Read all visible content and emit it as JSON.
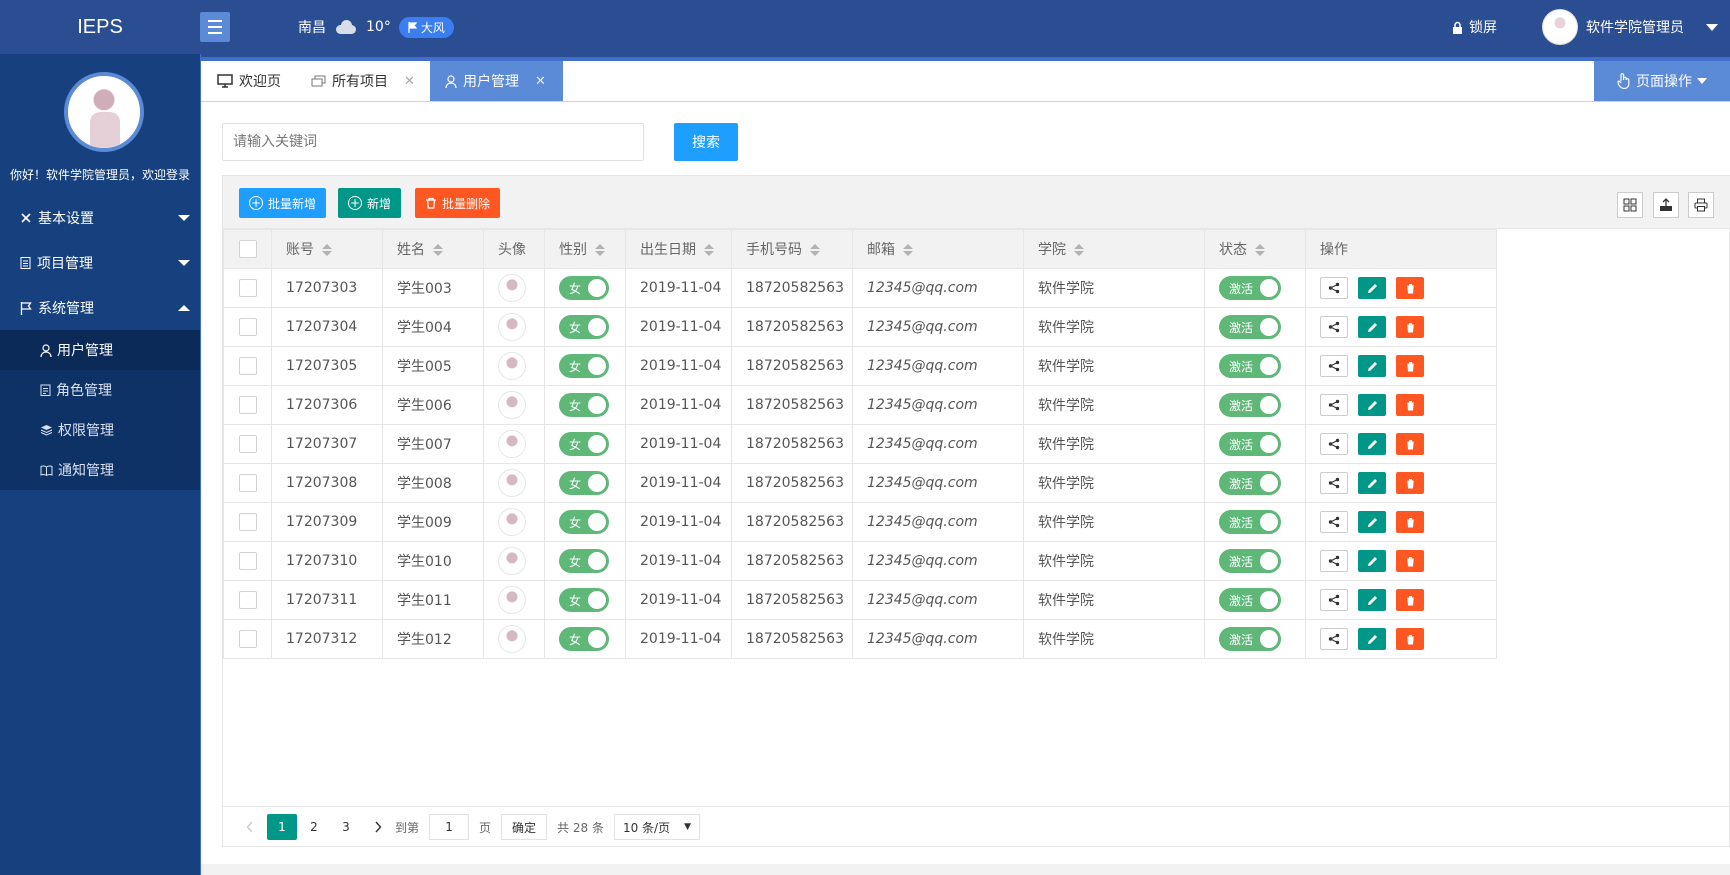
{
  "app": {
    "logo": "IEPS"
  },
  "header": {
    "city": "南昌",
    "temperature": "10°",
    "wind": "大风",
    "lock_label": "锁屏",
    "user_name": "软件学院管理员"
  },
  "sidebar": {
    "welcome": "你好！软件学院管理员，欢迎登录",
    "menus": [
      {
        "label": "基本设置",
        "icon": "tools-icon"
      },
      {
        "label": "项目管理",
        "icon": "document-icon"
      },
      {
        "label": "系统管理",
        "icon": "flag-icon"
      }
    ],
    "submenu": [
      {
        "label": "用户管理",
        "icon": "user-icon",
        "active": true
      },
      {
        "label": "角色管理",
        "icon": "clipboard-icon"
      },
      {
        "label": "权限管理",
        "icon": "layers-icon"
      },
      {
        "label": "通知管理",
        "icon": "book-icon"
      }
    ]
  },
  "tabs": [
    {
      "label": "欢迎页",
      "icon": "monitor-icon"
    },
    {
      "label": "所有项目",
      "icon": "folders-icon"
    },
    {
      "label": "用户管理",
      "icon": "user-icon",
      "active": true
    }
  ],
  "page_op": "页面操作",
  "search": {
    "placeholder": "请输入关键词",
    "button": "搜索"
  },
  "toolbar": {
    "batch_add": "批量新增",
    "add": "新增",
    "batch_delete": "批量删除"
  },
  "table": {
    "columns": [
      "账号",
      "姓名",
      "头像",
      "性别",
      "出生日期",
      "手机号码",
      "邮箱",
      "学院",
      "状态",
      "操作"
    ],
    "rows": [
      {
        "account": "17207303",
        "name": "学生003",
        "sex": "女",
        "birth": "2019-11-04",
        "phone": "18720582563",
        "email": "12345@qq.com",
        "college": "软件学院",
        "status": "激活"
      },
      {
        "account": "17207304",
        "name": "学生004",
        "sex": "女",
        "birth": "2019-11-04",
        "phone": "18720582563",
        "email": "12345@qq.com",
        "college": "软件学院",
        "status": "激活"
      },
      {
        "account": "17207305",
        "name": "学生005",
        "sex": "女",
        "birth": "2019-11-04",
        "phone": "18720582563",
        "email": "12345@qq.com",
        "college": "软件学院",
        "status": "激活"
      },
      {
        "account": "17207306",
        "name": "学生006",
        "sex": "女",
        "birth": "2019-11-04",
        "phone": "18720582563",
        "email": "12345@qq.com",
        "college": "软件学院",
        "status": "激活"
      },
      {
        "account": "17207307",
        "name": "学生007",
        "sex": "女",
        "birth": "2019-11-04",
        "phone": "18720582563",
        "email": "12345@qq.com",
        "college": "软件学院",
        "status": "激活"
      },
      {
        "account": "17207308",
        "name": "学生008",
        "sex": "女",
        "birth": "2019-11-04",
        "phone": "18720582563",
        "email": "12345@qq.com",
        "college": "软件学院",
        "status": "激活"
      },
      {
        "account": "17207309",
        "name": "学生009",
        "sex": "女",
        "birth": "2019-11-04",
        "phone": "18720582563",
        "email": "12345@qq.com",
        "college": "软件学院",
        "status": "激活"
      },
      {
        "account": "17207310",
        "name": "学生010",
        "sex": "女",
        "birth": "2019-11-04",
        "phone": "18720582563",
        "email": "12345@qq.com",
        "college": "软件学院",
        "status": "激活"
      },
      {
        "account": "17207311",
        "name": "学生011",
        "sex": "女",
        "birth": "2019-11-04",
        "phone": "18720582563",
        "email": "12345@qq.com",
        "college": "软件学院",
        "status": "激活"
      },
      {
        "account": "17207312",
        "name": "学生012",
        "sex": "女",
        "birth": "2019-11-04",
        "phone": "18720582563",
        "email": "12345@qq.com",
        "college": "软件学院",
        "status": "激活"
      }
    ]
  },
  "pagination": {
    "pages": [
      "1",
      "2",
      "3"
    ],
    "current": "1",
    "goto_label": "到第",
    "goto_value": "1",
    "page_unit": "页",
    "confirm": "确定",
    "total": "共 28 条",
    "page_size": "10 条/页"
  },
  "colors": {
    "header": "#2b4e92",
    "sidebar": "#16407e",
    "accent": "#5b8ad6",
    "primary": "#1e9fff",
    "green": "#009688",
    "red": "#ff5722",
    "switch": "#5fb878"
  }
}
